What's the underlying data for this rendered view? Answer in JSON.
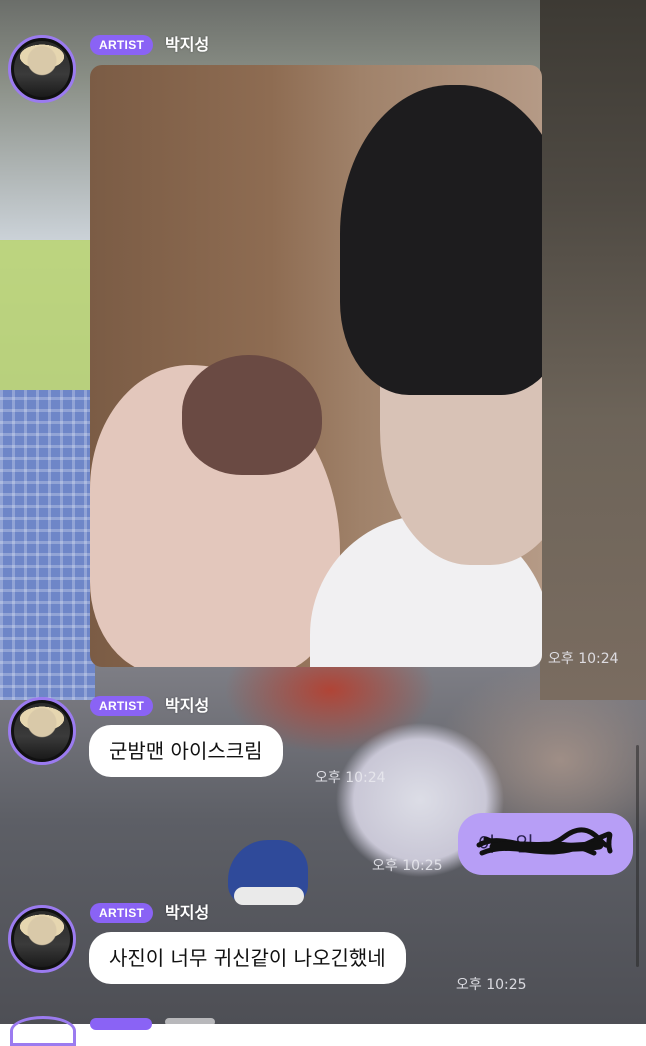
{
  "messages": [
    {
      "badge": "ARTIST",
      "sender": "박지성",
      "type": "photo",
      "time": "오후 10:24"
    },
    {
      "badge": "ARTIST",
      "sender": "박지성",
      "type": "text",
      "text": "군밤맨 아이스크림",
      "time": "오후 10:24"
    },
    {
      "type": "my-text",
      "text": "아...읽",
      "redacted": true,
      "time": "오후 10:25"
    },
    {
      "badge": "ARTIST",
      "sender": "박지성",
      "type": "text",
      "text": "사진이 너무 귀신같이 나오긴했네",
      "time": "오후 10:25"
    }
  ],
  "colors": {
    "badge": "#8a63f5",
    "my_bubble": "#b79ef6",
    "avatar_ring": "#9b7bf0"
  }
}
